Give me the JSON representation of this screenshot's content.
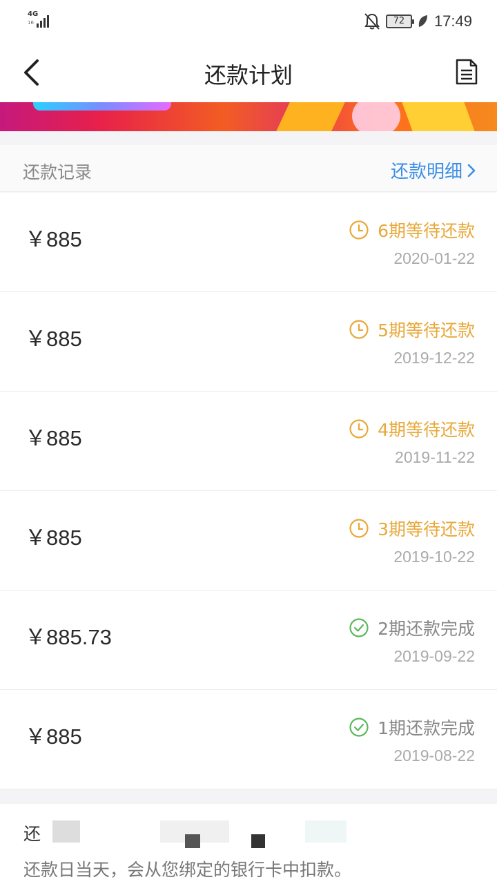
{
  "status_bar": {
    "network": "4G",
    "network_sub": "16",
    "battery": "72",
    "time": "17:49"
  },
  "nav": {
    "title": "还款计划"
  },
  "section": {
    "title": "还款记录",
    "detail_link": "还款明细"
  },
  "records": [
    {
      "amount": "￥885",
      "status": "6期等待还款",
      "state": "pending",
      "date": "2020-01-22"
    },
    {
      "amount": "￥885",
      "status": "5期等待还款",
      "state": "pending",
      "date": "2019-12-22"
    },
    {
      "amount": "￥885",
      "status": "4期等待还款",
      "state": "pending",
      "date": "2019-11-22"
    },
    {
      "amount": "￥885",
      "status": "3期等待还款",
      "state": "pending",
      "date": "2019-10-22"
    },
    {
      "amount": "￥885.73",
      "status": "2期还款完成",
      "state": "done",
      "date": "2019-09-22"
    },
    {
      "amount": "￥885",
      "status": "1期还款完成",
      "state": "done",
      "date": "2019-08-22"
    }
  ],
  "notice": {
    "title": "还",
    "text": "还款日当天，会从您绑定的银行卡中扣款。"
  },
  "colors": {
    "pending": "#e8a83a",
    "done": "#5cb85c",
    "link": "#3a8ee6"
  }
}
